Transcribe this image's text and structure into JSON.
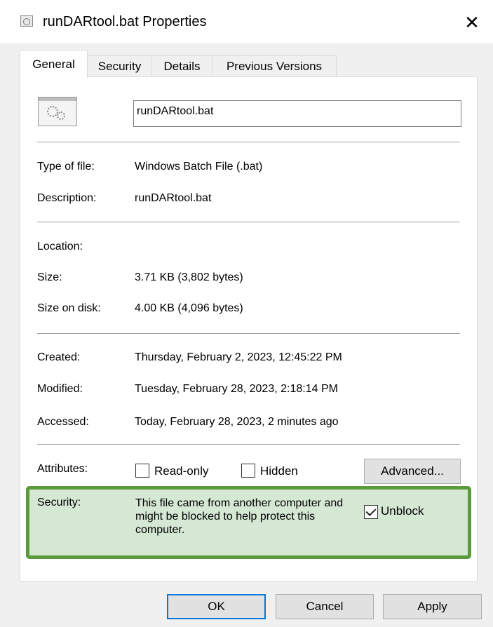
{
  "window": {
    "title": "runDARtool.bat Properties"
  },
  "tabs": [
    {
      "label": "General",
      "active": true
    },
    {
      "label": "Security",
      "active": false
    },
    {
      "label": "Details",
      "active": false
    },
    {
      "label": "Previous Versions",
      "active": false
    }
  ],
  "general": {
    "file_icon": "batch-file-gears-icon",
    "file_name": "runDARtool.bat",
    "type_label": "Type of file:",
    "type_value": "Windows Batch File (.bat)",
    "description_label": "Description:",
    "description_value": "runDARtool.bat",
    "location_label": "Location:",
    "location_value": "",
    "size_label": "Size:",
    "size_value": "3.71 KB (3,802 bytes)",
    "size_on_disk_label": "Size on disk:",
    "size_on_disk_value": "4.00 KB (4,096 bytes)",
    "created_label": "Created:",
    "created_value": "Thursday, February 2, 2023, 12:45:22 PM",
    "modified_label": "Modified:",
    "modified_value": "Tuesday, February 28, 2023, 2:18:14 PM",
    "accessed_label": "Accessed:",
    "accessed_value": "Today, February 28, 2023, 2 minutes ago",
    "attributes_label": "Attributes:",
    "readonly_label": "Read-only",
    "readonly_checked": false,
    "hidden_label": "Hidden",
    "hidden_checked": false,
    "advanced_label": "Advanced...",
    "security_label": "Security:",
    "security_text": "This file came from another computer and might be blocked to help protect this computer.",
    "unblock_label": "Unblock",
    "unblock_checked": true,
    "highlight_color": "#5a9a3d"
  },
  "buttons": {
    "ok": "OK",
    "cancel": "Cancel",
    "apply": "Apply"
  }
}
